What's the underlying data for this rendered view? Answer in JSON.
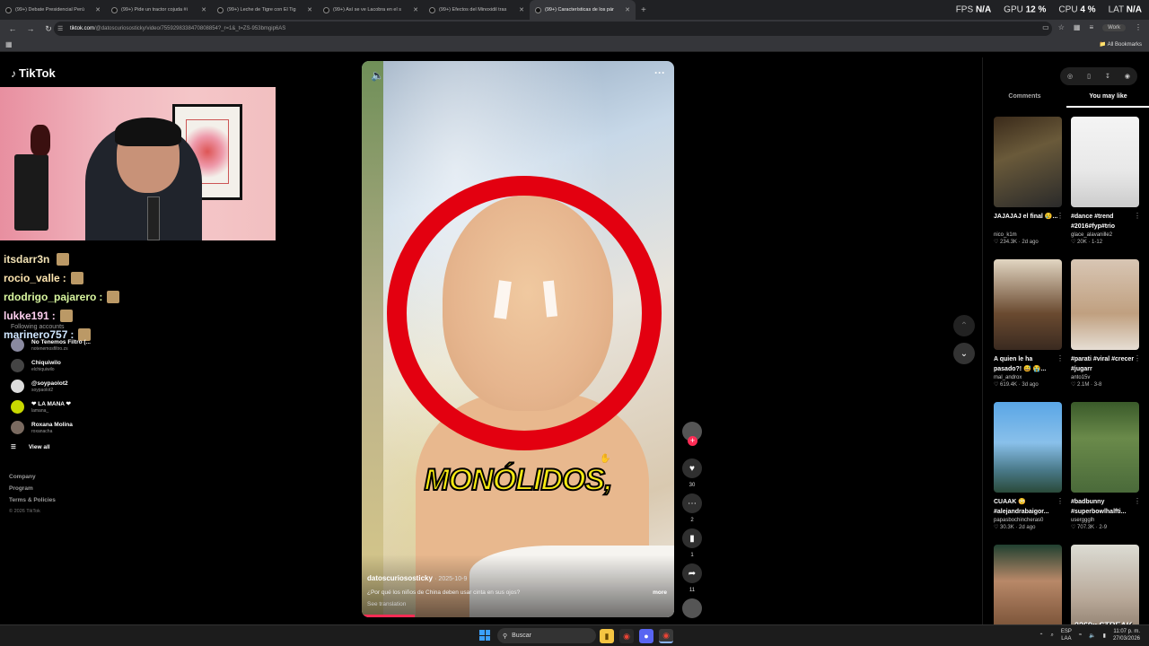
{
  "browser": {
    "tabs": [
      {
        "title": "(99+) Debate Presidencial Perú"
      },
      {
        "title": "(99+) Pide un tractor cojuda #i"
      },
      {
        "title": "(99+) Leche de Tigre con El Tig"
      },
      {
        "title": "(99+) Así se ve Lacobra en el s"
      },
      {
        "title": "(99+) Efectos del Minoxidil tras"
      },
      {
        "title": "(99+) Características de los pár"
      }
    ],
    "new_tab": "+",
    "stats": {
      "fps_label": "FPS",
      "fps": "N/A",
      "gpu_label": "GPU",
      "gpu": "12 %",
      "cpu_label": "CPU",
      "cpu": "4 %",
      "lat_label": "LAT",
      "lat": "N/A"
    },
    "url_host": "tiktok.com",
    "url_rest": "/@datoscuriososticky/video/7559298338470808854?_r=1&_t=ZS-953bmgip6AS",
    "profile_label": "Work",
    "all_bookmarks": "All Bookmarks"
  },
  "tiktok": {
    "logo": "TikTok",
    "chat": [
      {
        "user": "itsdarr3n",
        "sep": ""
      },
      {
        "user": "rocio_valle",
        "sep": ":"
      },
      {
        "user": "rdodrigo_pajarero",
        "sep": ":"
      },
      {
        "user": "lukke191",
        "sep": ":"
      },
      {
        "user": "marinero757",
        "sep": ":"
      }
    ],
    "faint_more": "More",
    "faint_following": "Following accounts",
    "following": [
      {
        "name": "No Tenemos Filtro (...",
        "handle": "notenemosfiltro.zs",
        "color": "#8a8aa0"
      },
      {
        "name": "Chiquiwilo",
        "handle": "elchiquiwilo",
        "color": "#444"
      },
      {
        "name": "@soypaolot2",
        "handle": "soypaolot2",
        "color": "#ddd"
      },
      {
        "name": "❤ LA MANA ❤",
        "handle": "lamana_",
        "color": "#c8d800"
      },
      {
        "name": "Roxana Molina",
        "handle": "roxanacha",
        "color": "#7a6a60"
      }
    ],
    "view_all": "View all",
    "footer": [
      "Company",
      "Program",
      "Terms & Policies"
    ],
    "copyright": "© 2026 TikTok",
    "video": {
      "caption": "MONÓLIDOS,",
      "username": "datoscuriososticky",
      "date": "· 2025-10-9",
      "description": "¿Por qué los niños de China deben usar cinta en sus ojos?",
      "more": "more",
      "see_translation": "See translation",
      "progress": 0.17
    },
    "actions": {
      "likes": "30",
      "comments": "2",
      "saves": "1",
      "shares": "11"
    },
    "right_tabs": {
      "comments": "Comments",
      "you_may_like": "You may like"
    },
    "cards": [
      {
        "title": "JAJAJAJ el final 😢...",
        "user": "nico_k1m",
        "meta": "♡ 234.3K · 2d ago",
        "bg": "linear-gradient(160deg,#3a2a1a,#6a5a3a 40%,#2a2a2a)"
      },
      {
        "title": "#dance #trend #2016#fyp#trio",
        "user": "glace_alavanille2",
        "meta": "♡ 20K · 1-12",
        "bg": "linear-gradient(#f4f4f4,#e8e8e8 60%,#ccc)"
      },
      {
        "title": "A quien le ha pasado?! 😅 😭...",
        "user": "mal_androx",
        "meta": "♡ 619.4K · 3d ago",
        "bg": "linear-gradient(#e2d6c2,#6a4a30 60%,#3a2a20)"
      },
      {
        "title": "#parati #viral #crecer #jugarr",
        "user": "anto15v",
        "meta": "♡ 2.1M · 3-8",
        "bg": "linear-gradient(#d8c6b4,#c0a080 60%,#e6ded4)"
      },
      {
        "title": "CUAAK 😳 #alejandrabaigor...",
        "user": "papasbochincheras0",
        "meta": "♡ 30.3K · 2d ago",
        "bg": "linear-gradient(#5aa6e6,#89c0ea 45%,#4a7a8a 75%,#2a4a3a)"
      },
      {
        "title": "#badbunny #superbowlhalfti...",
        "user": "userggglh",
        "meta": "♡ 707.3K · 2-9",
        "bg": "linear-gradient(#3a5a2a,#6a8a4a 40%,#4a6a3a)"
      },
      {
        "title": "",
        "user": "",
        "meta": "",
        "bg": "linear-gradient(#204030,#b88868 40%,#704a30)"
      },
      {
        "title": "",
        "user": "",
        "meta": "",
        "bg": "linear-gradient(#dcdcd4,#b8a898 60%,#8a7a6a)",
        "overlay": "2269x STREAK"
      }
    ]
  },
  "taskbar": {
    "search": "Buscar",
    "lang1": "ESP",
    "lang2": "LAA",
    "time": "11:07 p. m.",
    "date": "27/03/2026"
  }
}
